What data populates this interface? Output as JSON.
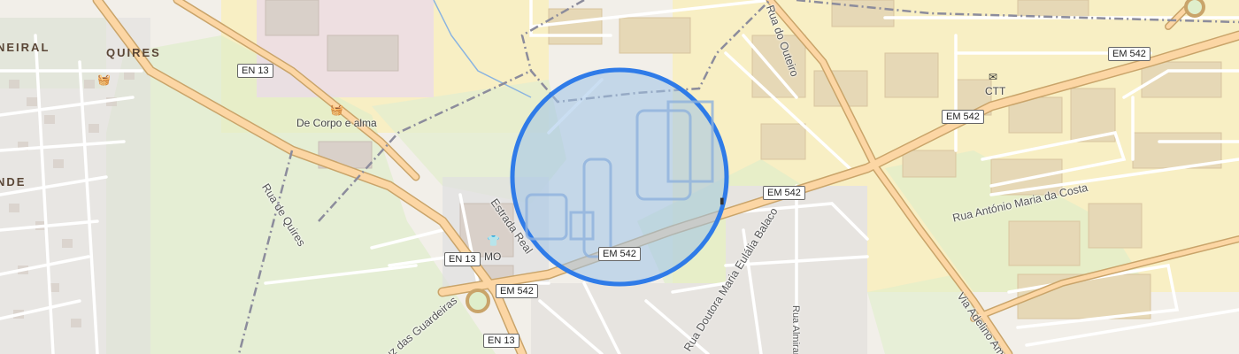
{
  "map": {
    "places": [
      {
        "id": "neiral",
        "text": "NEIRAL"
      },
      {
        "id": "quires",
        "text": "QUIRES"
      },
      {
        "id": "nde",
        "text": "NDE"
      }
    ],
    "streets": [
      {
        "id": "rua-de-quires",
        "text": "Rua de Quires"
      },
      {
        "id": "estrada-real",
        "text": "Estrada Real"
      },
      {
        "id": "rua-do-outeiro",
        "text": "Rua do Outeiro"
      },
      {
        "id": "rua-antonio-maria-da-costa",
        "text": "Rua António Maria da Costa"
      },
      {
        "id": "rua-doutora-maria-eulalia-balaco",
        "text": "Rua Doutora Maria Eulália Balaco"
      },
      {
        "id": "via-adelino-amaro",
        "text": "Via Adelino Amaro"
      },
      {
        "id": "rua-das-gueirelas",
        "text": "uz das Guardeiras"
      },
      {
        "id": "rua-vertical",
        "text": "Rua Almirante"
      }
    ],
    "route_shields": [
      {
        "id": "en13-a",
        "text": "EN 13"
      },
      {
        "id": "en13-b",
        "text": "EN 13"
      },
      {
        "id": "en13-c",
        "text": "EN 13"
      },
      {
        "id": "em542-a",
        "text": "EM 542"
      },
      {
        "id": "em542-b",
        "text": "EM 542"
      },
      {
        "id": "em542-c",
        "text": "EM 542"
      },
      {
        "id": "em542-d",
        "text": "EM 542"
      },
      {
        "id": "em542-e",
        "text": "EM 542"
      }
    ],
    "pois": [
      {
        "id": "de-corpo-e-alma",
        "text": "De Corpo e alma",
        "icon": "shopping-basket-icon"
      },
      {
        "id": "mo",
        "text": "MO",
        "icon": "clothing-shop-icon"
      },
      {
        "id": "ctt",
        "text": "CTT",
        "icon": "post-office-icon"
      }
    ],
    "colors": {
      "background": "#f2efe9",
      "residential": "#e0dfdf",
      "industrial": "#ebdbe8",
      "commercial": "#f8efc4",
      "grass": "#dfeecb",
      "primary_road": "#fcd6a4",
      "road_casing": "#c9a46a",
      "boundary": "#8c8c9c",
      "selection_fill": "#9fc2e8",
      "selection_stroke": "#2f7be8"
    },
    "selection_circle": {
      "shape": "circle",
      "note_visible": false
    }
  }
}
